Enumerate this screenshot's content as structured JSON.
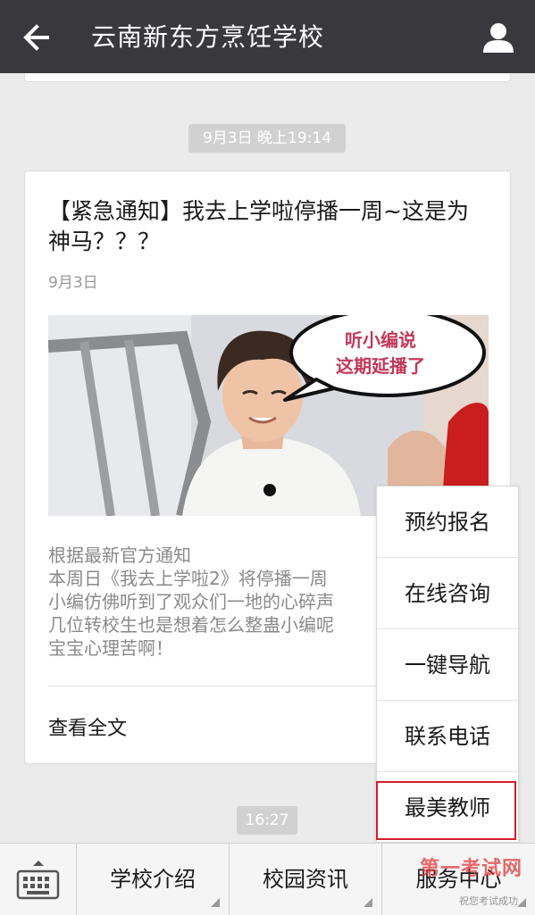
{
  "header": {
    "title": "云南新东方烹饪学校",
    "back_icon": "arrow-left-icon",
    "profile_icon": "person-icon"
  },
  "messages": {
    "timestamp1": "9月3日 晚上19:14",
    "timestamp2": "16:27"
  },
  "article": {
    "title": "【紧急通知】我去上学啦停播一周~这是为神马？？？",
    "date": "9月3日",
    "image_bubble_line1": "听小编说",
    "image_bubble_line2": "这期延播了",
    "summary": [
      "根据最新官方通知",
      "本周日《我去上学啦2》将停播一周",
      "小编仿佛听到了观众们一地的心碎声",
      "几位转校生也是想着怎么整蛊小编呢",
      "宝宝心理苦啊！"
    ],
    "read_more": "查看全文"
  },
  "popup_menu": {
    "items": [
      "预约报名",
      "在线咨询",
      "一键导航",
      "联系电话",
      "最美教师"
    ],
    "highlighted_index": 4,
    "highlight_color": "#d21f2a"
  },
  "bottom_menu": {
    "keyboard_icon": "keyboard-icon",
    "tabs": [
      "学校介绍",
      "校园资讯",
      "服务中心"
    ]
  },
  "watermark": {
    "main": "第一考试网",
    "sub": "祝您考试成功"
  }
}
